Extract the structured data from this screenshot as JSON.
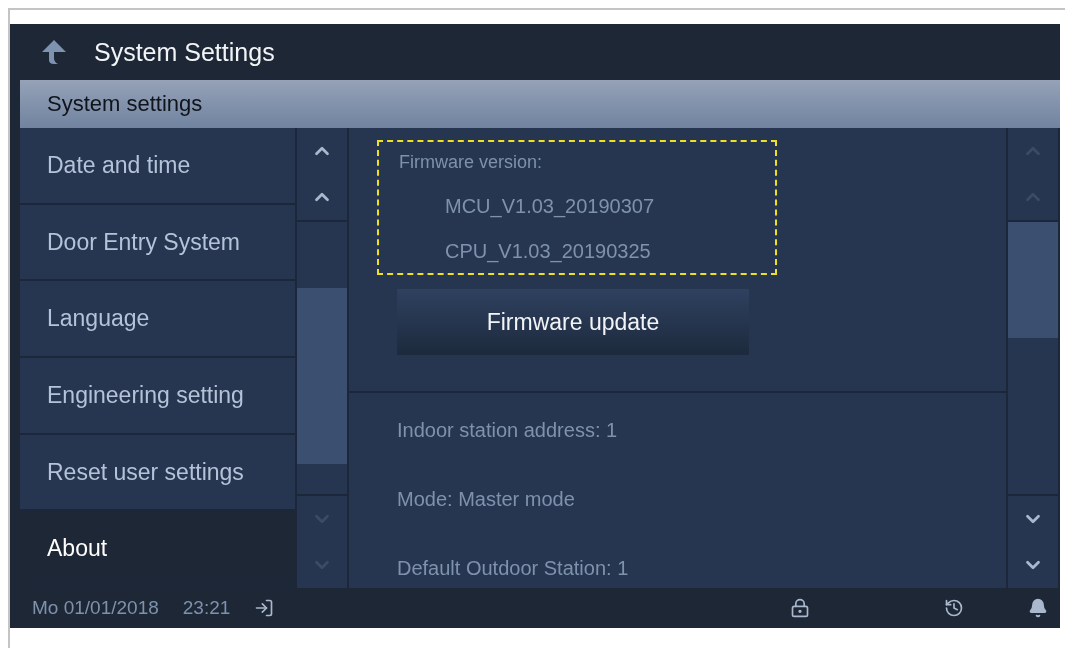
{
  "window": {
    "title": "System Settings"
  },
  "section_header": "System settings",
  "sidebar": {
    "items": [
      {
        "label": "Date and time",
        "selected": false
      },
      {
        "label": "Door Entry System",
        "selected": false
      },
      {
        "label": "Language",
        "selected": false
      },
      {
        "label": "Engineering setting",
        "selected": false
      },
      {
        "label": "Reset user settings",
        "selected": false
      },
      {
        "label": "About",
        "selected": true
      }
    ],
    "scroll_up_disabled": false,
    "scroll_down_disabled": true
  },
  "firmware": {
    "label": "Firmware version:",
    "versions": [
      "MCU_V1.03_20190307",
      "CPU_V1.03_20190325"
    ],
    "button": "Firmware update"
  },
  "info": [
    "Indoor station address: 1",
    "Mode: Master mode",
    "Default Outdoor Station: 1"
  ],
  "content_scroll": {
    "scroll_up_disabled": true,
    "scroll_down_disabled": false
  },
  "status_bar": {
    "date": "Mo 01/01/2018",
    "time": "23:21"
  }
}
